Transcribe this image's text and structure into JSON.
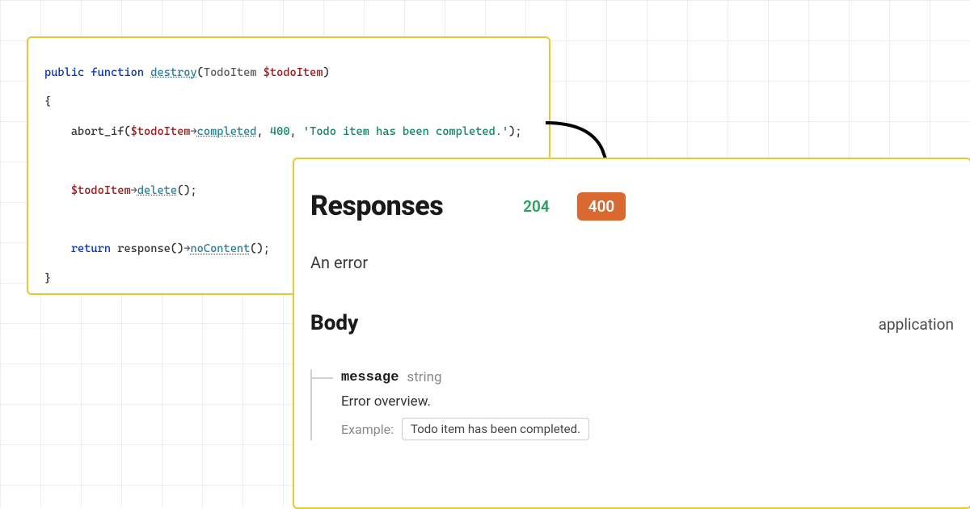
{
  "code": {
    "keyword_public": "public",
    "keyword_function": "function",
    "func_name": "destroy",
    "type_name": "TodoItem",
    "var_todoitem": "$todoItem",
    "abort_if": "abort_if",
    "completed": "completed",
    "status_code": "400",
    "abort_message": "'Todo item has been completed.'",
    "delete": "delete",
    "return_kw": "return",
    "response": "response",
    "no_content": "noContent"
  },
  "responses": {
    "title": "Responses",
    "status_204": "204",
    "status_400": "400",
    "error_text": "An error",
    "body_title": "Body",
    "content_type": "application",
    "field_name": "message",
    "field_type": "string",
    "field_desc": "Error overview.",
    "example_label": "Example:",
    "example_value": "Todo item has been completed."
  }
}
